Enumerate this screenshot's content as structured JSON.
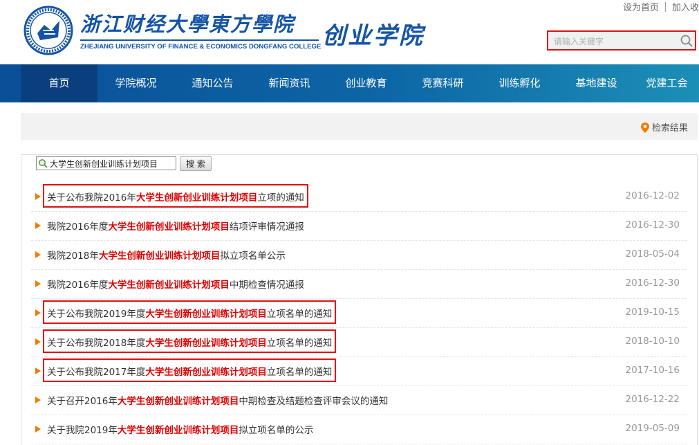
{
  "header": {
    "top_links": [
      "设为首页",
      "加入收"
    ],
    "college_name_cn": "浙江财经大學東方學院",
    "college_name_en": "ZHEJIANG UNIVERSITY OF FINANCE & ECONOMICS DONGFANG COLLEGE",
    "school_name": "创业学院",
    "search_placeholder": "请输入关键字"
  },
  "nav": {
    "items": [
      "首页",
      "学院概况",
      "通知公告",
      "新闻资讯",
      "创业教育",
      "竞赛科研",
      "训练孵化",
      "基地建设",
      "党建工会"
    ],
    "active_index": 0
  },
  "breadcrumb": {
    "label": "检索结果"
  },
  "search_form": {
    "query": "大学生创新创业训练计划项目",
    "button_label": "搜 索"
  },
  "results": [
    {
      "prefix": "关于公布我院2016年",
      "keyword": "大学生创新创业训练计划项目",
      "suffix": "立项的通知",
      "date": "2016-12-02",
      "highlighted": true
    },
    {
      "prefix": "我院2016年度",
      "keyword": "大学生创新创业训练计划项目",
      "suffix": "结项评审情况通报",
      "date": "2016-12-30",
      "highlighted": false
    },
    {
      "prefix": "我院2018年",
      "keyword": "大学生创新创业训练计划项目",
      "suffix": "拟立项名单公示",
      "date": "2018-05-04",
      "highlighted": false
    },
    {
      "prefix": "我院2016年度",
      "keyword": "大学生创新创业训练计划项目",
      "suffix": "中期检查情况通报",
      "date": "2016-12-30",
      "highlighted": false
    },
    {
      "prefix": "关于公布我院2019年度",
      "keyword": "大学生创新创业训练计划项目",
      "suffix": "立项名单的通知",
      "date": "2019-10-15",
      "highlighted": true
    },
    {
      "prefix": "关于公布我院2018年度",
      "keyword": "大学生创新创业训练计划项目",
      "suffix": "立项名单的通知",
      "date": "2018-10-10",
      "highlighted": true
    },
    {
      "prefix": "关于公布我院2017年度",
      "keyword": "大学生创新创业训练计划项目",
      "suffix": "立项名单的通知",
      "date": "2017-10-16",
      "highlighted": true
    },
    {
      "prefix": "关于召开2016年",
      "keyword": "大学生创新创业训练计划项目",
      "suffix": "中期检查及结题检查评审会议的通知",
      "date": "2016-12-22",
      "highlighted": false
    },
    {
      "prefix": "关于我院2019年",
      "keyword": "大学生创新创业训练计划项目",
      "suffix": "拟立项名单的公示",
      "date": "2019-05-09",
      "highlighted": false
    }
  ],
  "colors": {
    "brand_blue": "#1454a7",
    "nav_active": "#0a3f7e",
    "keyword_red": "#dd0000",
    "highlight_box": "#e01010",
    "bullet_orange": "#ef7d00"
  },
  "icons": [
    "college-seal-logo",
    "search-icon",
    "location-pin-icon",
    "magnifier-icon",
    "triangle-bullet-icon"
  ]
}
